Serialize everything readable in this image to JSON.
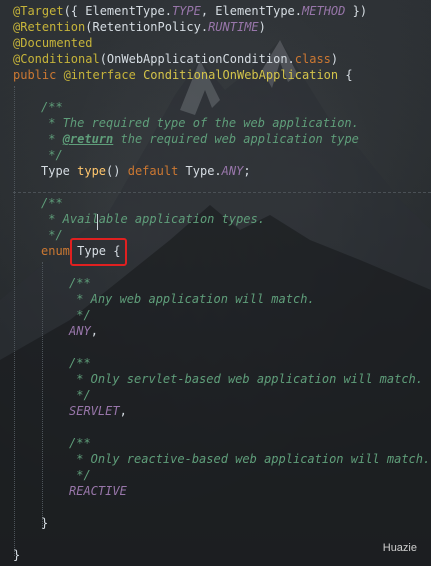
{
  "code_lines": {
    "l1": {
      "a1": "@Target",
      "a2": "({ ElementType.",
      "a3": "TYPE",
      "a4": ", ElementType.",
      "a5": "METHOD",
      "a6": " })"
    },
    "l2": {
      "a1": "@Retention",
      "a2": "(RetentionPolicy.",
      "a3": "RUNTIME",
      "a4": ")"
    },
    "l3": {
      "a1": "@Documented"
    },
    "l4": {
      "a1": "@Conditional",
      "a2": "(OnWebApplicationCondition.",
      "a3": "class",
      "a4": ")"
    },
    "l5": {
      "a1": "public ",
      "a2": "@interface ",
      "a3": "ConditionalOnWebApplication",
      "a4": " {"
    },
    "l6": {
      "a1": "/**"
    },
    "l7": {
      "a1": " * The required type of the web application."
    },
    "l8": {
      "a1": " * ",
      "a2": "@return",
      "a3": " the required web application type"
    },
    "l9": {
      "a1": " */"
    },
    "l10": {
      "a1": "Type ",
      "a2": "type",
      "a3": "() ",
      "a4": "default ",
      "a5": "Type.",
      "a6": "ANY",
      "a7": ";"
    },
    "l11": {
      "a1": "/**"
    },
    "l12": {
      "a1": " * Available application types."
    },
    "l13": {
      "a1": " */"
    },
    "l14": {
      "a1": "enum ",
      "a2": "Type {"
    },
    "l15": {
      "a1": "/**"
    },
    "l16": {
      "a1": " * Any web application will match."
    },
    "l17": {
      "a1": " */"
    },
    "l18": {
      "a1": "ANY",
      "a2": ","
    },
    "l19": {
      "a1": "/**"
    },
    "l20": {
      "a1": " * Only servlet-based web application will match."
    },
    "l21": {
      "a1": " */"
    },
    "l22": {
      "a1": "SERVLET",
      "a2": ","
    },
    "l23": {
      "a1": "/**"
    },
    "l24": {
      "a1": " * Only reactive-based web application will match."
    },
    "l25": {
      "a1": " */"
    },
    "l26": {
      "a1": "REACTIVE"
    },
    "l27": {
      "a1": "}"
    },
    "l28": {
      "a1": "}"
    }
  },
  "watermark": "Huazie",
  "colors": {
    "annotation": "#c6b43a",
    "keyword": "#cc7832",
    "constant": "#9876aa",
    "doc_comment": "#5f9e7a",
    "highlight_box": "#e02020"
  }
}
